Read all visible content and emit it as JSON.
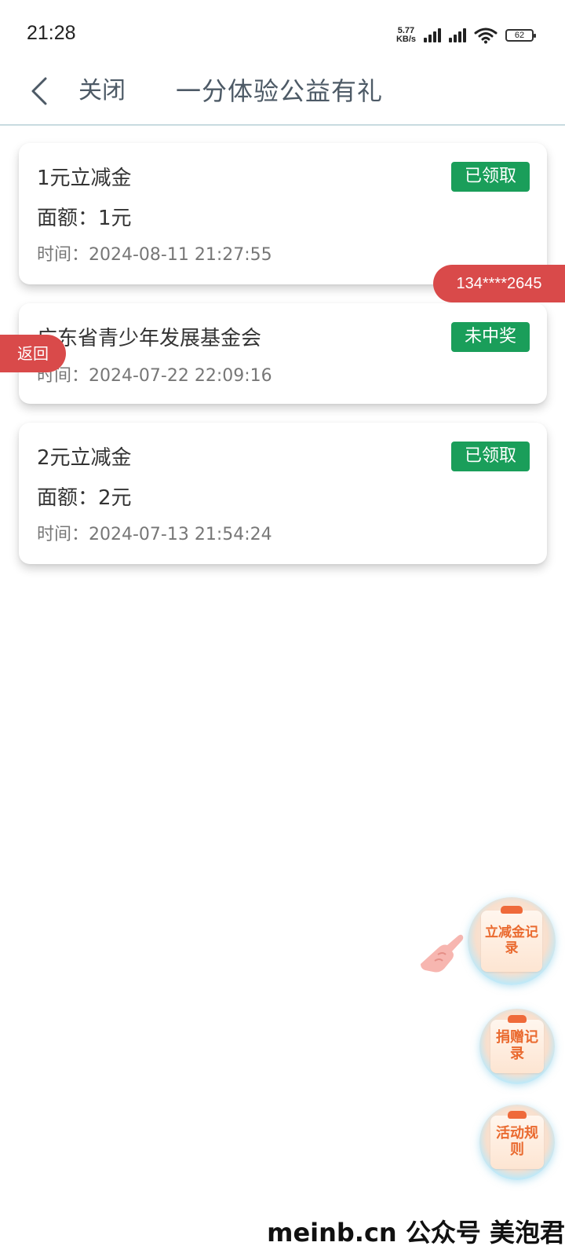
{
  "status_bar": {
    "time": "21:28",
    "net_speed_value": "5.77",
    "net_speed_unit": "KB/s",
    "battery": "62"
  },
  "header": {
    "close_label": "关闭",
    "title": "一分体验公益有礼"
  },
  "records": [
    {
      "title": "1元立减金",
      "amount": "面额：1元",
      "time": "时间：2024-08-11 21:27:55",
      "status": "已领取",
      "status_color": "#1a9e5a"
    },
    {
      "title": "广东省青少年发展基金会",
      "time": "时间：2024-07-22 22:09:16",
      "status": "未中奖",
      "status_color": "#1a9e5a"
    },
    {
      "title": "2元立减金",
      "amount": "面额：2元",
      "time": "时间：2024-07-13 21:54:24",
      "status": "已领取",
      "status_color": "#1a9e5a"
    }
  ],
  "phone_tag": "134****2645",
  "return_label": "返回",
  "floating_buttons": {
    "coupon_records": "立减金记录",
    "donation_records": "捐赠记录",
    "activity_rules": "活动规则"
  },
  "watermark": "meinb.cn  公众号 美泡君",
  "colors": {
    "badge_green": "#1a9e5a",
    "tag_red": "#d94a4a",
    "header_text": "#4d5a66",
    "fab_text_orange": "#ea6a2f"
  }
}
